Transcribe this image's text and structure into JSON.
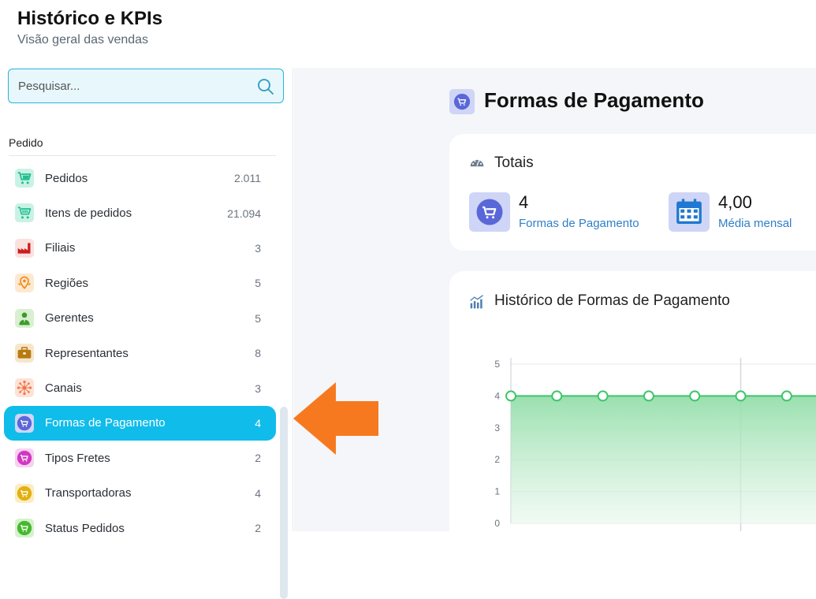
{
  "header": {
    "title": "Histórico e KPIs",
    "subtitle": "Visão geral das vendas"
  },
  "search": {
    "placeholder": "Pesquisar..."
  },
  "sidebar": {
    "section_label": "Pedido",
    "items": [
      {
        "label": "Pedidos",
        "count": "2.011",
        "icon": "cart-icon",
        "color": "#1fbf8f",
        "bg": "#c9f2e4"
      },
      {
        "label": "Itens de pedidos",
        "count": "21.094",
        "icon": "cart-plus-icon",
        "color": "#1fbf8f",
        "bg": "#c9f2e4"
      },
      {
        "label": "Filiais",
        "count": "3",
        "icon": "factory-icon",
        "color": "#c81e1e",
        "bg": "#fbe0e0"
      },
      {
        "label": "Regiões",
        "count": "5",
        "icon": "map-pin-icon",
        "color": "#f08a1c",
        "bg": "#fde9cf"
      },
      {
        "label": "Gerentes",
        "count": "5",
        "icon": "manager-icon",
        "color": "#3e9b2b",
        "bg": "#d8f0d0"
      },
      {
        "label": "Representantes",
        "count": "8",
        "icon": "briefcase-icon",
        "color": "#b87a12",
        "bg": "#f6e6c9"
      },
      {
        "label": "Canais",
        "count": "3",
        "icon": "network-icon",
        "color": "#f0754a",
        "bg": "#fde2d6"
      },
      {
        "label": "Formas de Pagamento",
        "count": "4",
        "icon": "cart-icon",
        "color": "#5a67d8",
        "bg": "#cfd5f6",
        "active": true
      },
      {
        "label": "Tipos Fretes",
        "count": "2",
        "icon": "cart-icon",
        "color": "#d336c2",
        "bg": "#f6d2f0"
      },
      {
        "label": "Transportadoras",
        "count": "4",
        "icon": "cart-icon",
        "color": "#e2b010",
        "bg": "#fbedc0"
      },
      {
        "label": "Status Pedidos",
        "count": "2",
        "icon": "cart-icon",
        "color": "#46b92e",
        "bg": "#d6f1cd"
      }
    ]
  },
  "page": {
    "title": "Formas de Pagamento",
    "accent": "#5a67d8"
  },
  "totais": {
    "title": "Totais",
    "kpis": [
      {
        "value": "4",
        "caption": "Formas de Pagamento",
        "icon": "cart-icon"
      },
      {
        "value": "4,00",
        "caption": "Média mensal",
        "icon": "calendar-icon"
      }
    ]
  },
  "historico": {
    "title": "Histórico de Formas de Pagamento"
  },
  "chart_data": {
    "type": "area",
    "title": "Histórico de Formas de Pagamento",
    "xlabel": "",
    "ylabel": "",
    "ylim": [
      0,
      5
    ],
    "yticks": [
      "0",
      "1",
      "2",
      "3",
      "4",
      "5"
    ],
    "grid": true,
    "series": [
      {
        "values": [
          4,
          4,
          4,
          4,
          4,
          4,
          4,
          4
        ],
        "color": "#3fc46b"
      }
    ]
  }
}
